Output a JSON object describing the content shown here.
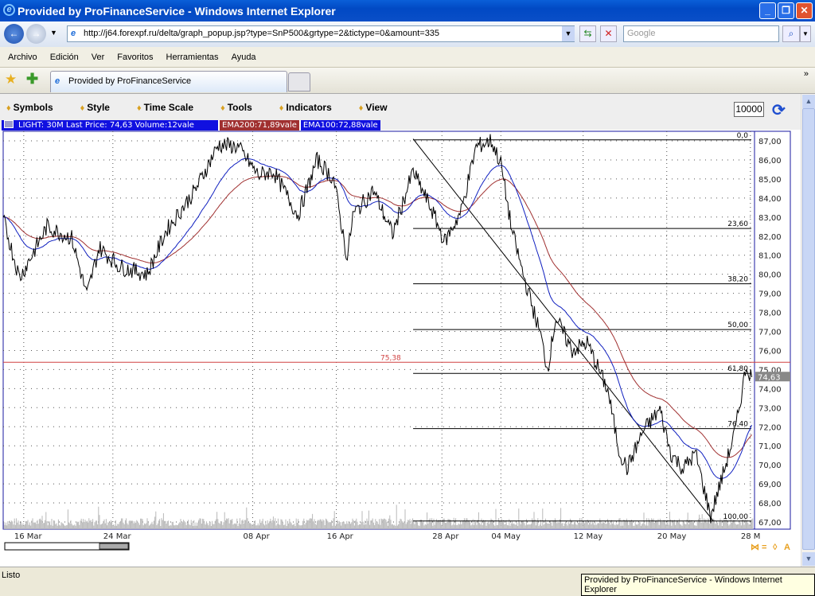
{
  "window": {
    "title": "Provided by ProFinanceService - Windows Internet Explorer"
  },
  "address": {
    "url": "http://j64.forexpf.ru/delta/graph_popup.jsp?type=SnP500&grtype=2&tictype=0&amount=335",
    "search_placeholder": "Google"
  },
  "menu": [
    "Archivo",
    "Edición",
    "Ver",
    "Favoritos",
    "Herramientas",
    "Ayuda"
  ],
  "tab": {
    "label": "Provided by ProFinanceService"
  },
  "chart_toolbar": {
    "items": [
      "Symbols",
      "Style",
      "Time Scale",
      "Tools",
      "Indicators",
      "View"
    ],
    "amount": "10000"
  },
  "legend": {
    "main": "LIGHT: 30M Last Price: 74,63 Volume:12vale",
    "ema200": "EMA200:71,89vale",
    "ema100": "EMA100:72,88vale"
  },
  "status": {
    "text": "Listo",
    "tooltip": "Provided by ProFinanceService - Windows Internet Explorer"
  },
  "colors": {
    "ema200": "#a03030",
    "ema100": "#1020c0",
    "price": "#000000",
    "hline": "#d04040",
    "frame": "#1a1aa0"
  },
  "chart_data": {
    "type": "line",
    "yticks": [
      "87,00",
      "86,00",
      "85,00",
      "84,00",
      "83,00",
      "82,00",
      "81,00",
      "80,00",
      "79,00",
      "78,00",
      "77,00",
      "76,00",
      "75,00",
      "74,00",
      "73,00",
      "72,00",
      "71,00",
      "70,00",
      "69,00",
      "68,00",
      "67,00"
    ],
    "ylim": [
      67,
      87
    ],
    "xticks": [
      {
        "label": "16 Mar",
        "t": 0
      },
      {
        "label": "24 Mar",
        "t": 6.5
      },
      {
        "label": "08 Apr",
        "t": 16.7
      },
      {
        "label": "16 Apr",
        "t": 22.8
      },
      {
        "label": "28 Apr",
        "t": 30.5
      },
      {
        "label": "04 May",
        "t": 34.8
      },
      {
        "label": "12 May",
        "t": 40.8
      },
      {
        "label": "20 May",
        "t": 46.9
      },
      {
        "label": "28 M",
        "t": 53
      }
    ],
    "xlim": [
      -1.5,
      53.3
    ],
    "last_price": "74,63",
    "horizontal_line": {
      "value": 75.38,
      "label": "75,38"
    },
    "fibonacci": {
      "start_t": 28.4,
      "end_t": 53.3,
      "levels": [
        {
          "label": "0,0",
          "value": 87.05
        },
        {
          "label": "23,60",
          "value": 82.4
        },
        {
          "label": "38,20",
          "value": 79.5
        },
        {
          "label": "50,00",
          "value": 77.1
        },
        {
          "label": "61,80",
          "value": 74.8
        },
        {
          "label": "76,40",
          "value": 71.9
        },
        {
          "label": "100,00",
          "value": 67.05
        }
      ]
    },
    "trendline": [
      {
        "t": 28.4,
        "value": 87.1
      },
      {
        "t": 50.3,
        "value": 67.05
      }
    ],
    "price_anchors": [
      [
        -1.5,
        82.9
      ],
      [
        -0.3,
        79.8
      ],
      [
        1.7,
        82.5
      ],
      [
        3.5,
        81.9
      ],
      [
        4.6,
        78.9
      ],
      [
        5.5,
        81.4
      ],
      [
        7.0,
        80.4
      ],
      [
        9.0,
        80.0
      ],
      [
        10.4,
        82.3
      ],
      [
        12.5,
        84.4
      ],
      [
        14.2,
        86.8
      ],
      [
        15.6,
        86.7
      ],
      [
        17.1,
        85.2
      ],
      [
        18.2,
        85.4
      ],
      [
        20.0,
        83.1
      ],
      [
        21.4,
        86.0
      ],
      [
        22.6,
        85.0
      ],
      [
        23.6,
        80.8
      ],
      [
        24.0,
        83.1
      ],
      [
        25.5,
        84.4
      ],
      [
        26.9,
        82.1
      ],
      [
        28.4,
        85.4
      ],
      [
        29.8,
        83.3
      ],
      [
        30.7,
        81.7
      ],
      [
        31.9,
        83.3
      ],
      [
        33.0,
        86.7
      ],
      [
        34.1,
        87.0
      ],
      [
        34.8,
        85.8
      ],
      [
        35.6,
        82.3
      ],
      [
        36.5,
        79.8
      ],
      [
        37.7,
        76.8
      ],
      [
        38.2,
        75.0
      ],
      [
        38.8,
        77.7
      ],
      [
        40.0,
        76.0
      ],
      [
        41.1,
        76.4
      ],
      [
        42.6,
        73.9
      ],
      [
        43.4,
        70.8
      ],
      [
        44.0,
        69.8
      ],
      [
        45.2,
        71.8
      ],
      [
        46.4,
        72.9
      ],
      [
        47.2,
        70.6
      ],
      [
        48.1,
        69.8
      ],
      [
        49.0,
        70.6
      ],
      [
        50.1,
        67.3
      ],
      [
        51.0,
        69.5
      ],
      [
        51.9,
        71.8
      ],
      [
        52.7,
        75.2
      ],
      [
        53.1,
        74.6
      ]
    ]
  }
}
